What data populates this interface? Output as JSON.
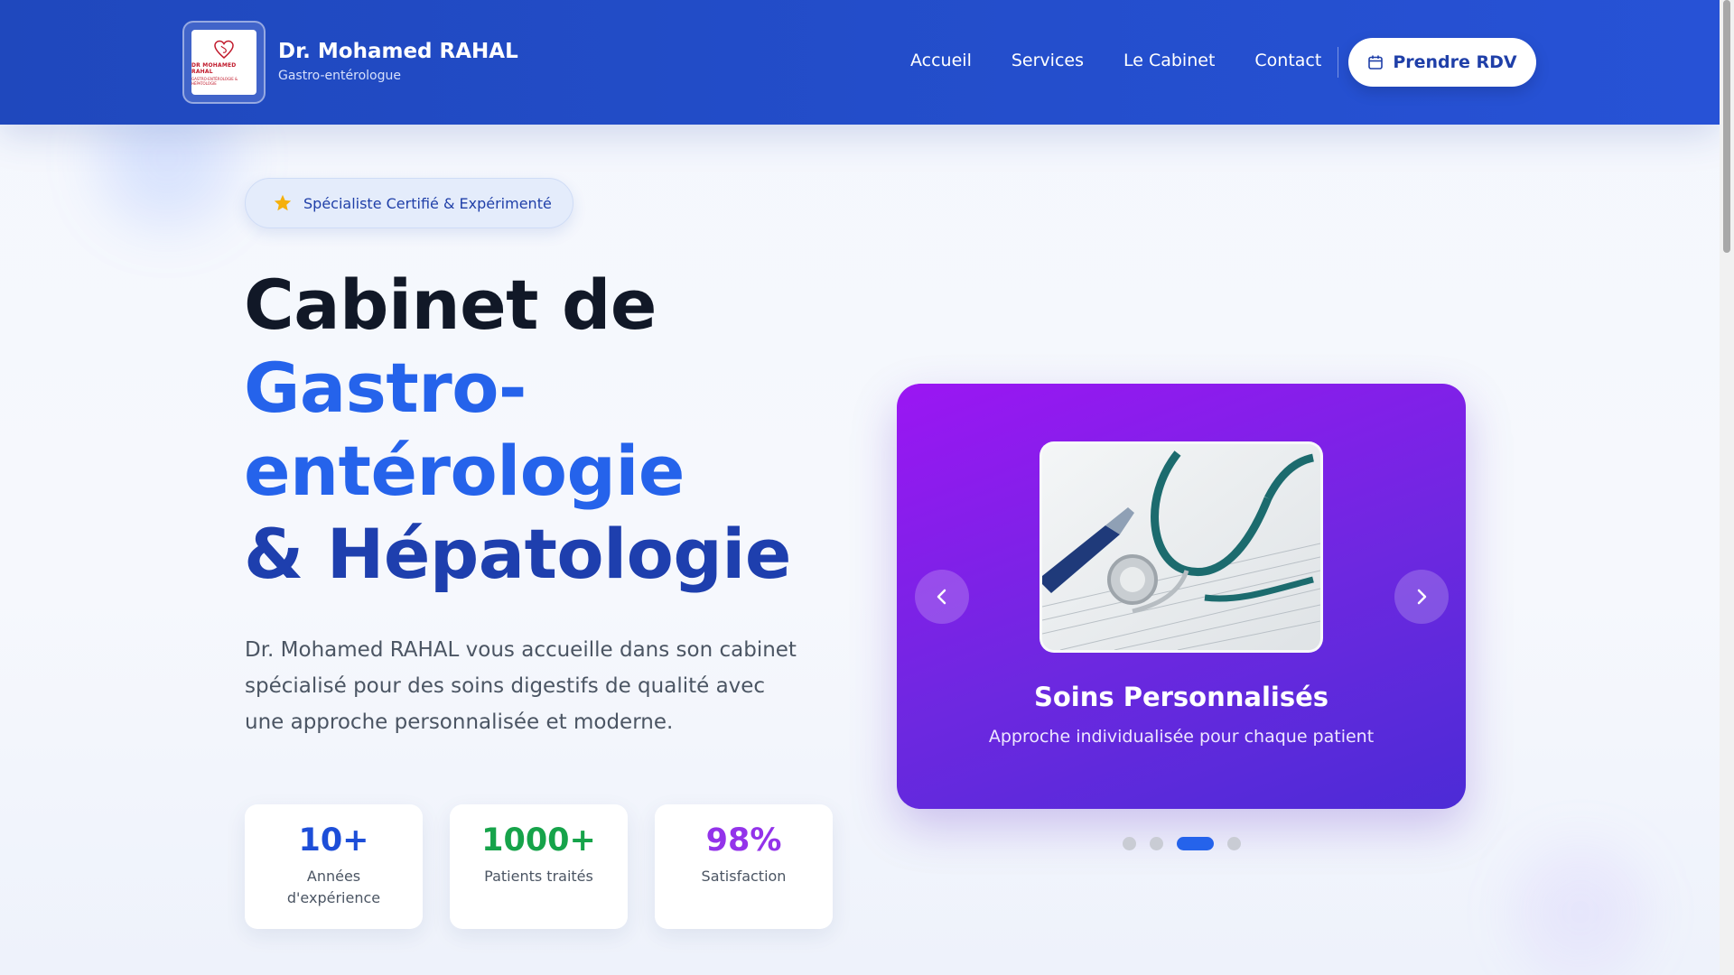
{
  "header": {
    "logo_text": "DR MOHAMED RAHAL",
    "logo_sub": "GASTRO-ENTÉROLOGIE & HÉPATOLOGIE",
    "brand_name": "Dr. Mohamed RAHAL",
    "brand_sub": "Gastro-entérologue",
    "nav": [
      "Accueil",
      "Services",
      "Le Cabinet",
      "Contact"
    ],
    "cta_label": "Prendre RDV"
  },
  "hero": {
    "badge_label": "Spécialiste Certifié & Expérimenté",
    "title_line1": "Cabinet de",
    "title_line2": "Gastro-",
    "title_line3": "entérologie",
    "title_line4": "& Hépatologie",
    "description": "Dr. Mohamed RAHAL vous accueille dans son cabinet spécialisé pour des soins digestifs de qualité avec une approche personnalisée et moderne."
  },
  "stats": [
    {
      "value": "10+",
      "label": "Années d'expérience",
      "color": "#1d4ed8"
    },
    {
      "value": "1000+",
      "label": "Patients traités",
      "color": "#16a34a"
    },
    {
      "value": "98%",
      "label": "Satisfaction",
      "color": "#9333ea"
    }
  ],
  "carousel": {
    "slide_title": "Soins Personnalisés",
    "slide_desc": "Approche individualisée pour chaque patient",
    "slide_count": 4,
    "active_index": 2
  },
  "colors": {
    "header_bg": "#2752d6",
    "accent": "#2563eb",
    "carousel_start": "#9b16f3",
    "carousel_end": "#4c2bd6"
  }
}
